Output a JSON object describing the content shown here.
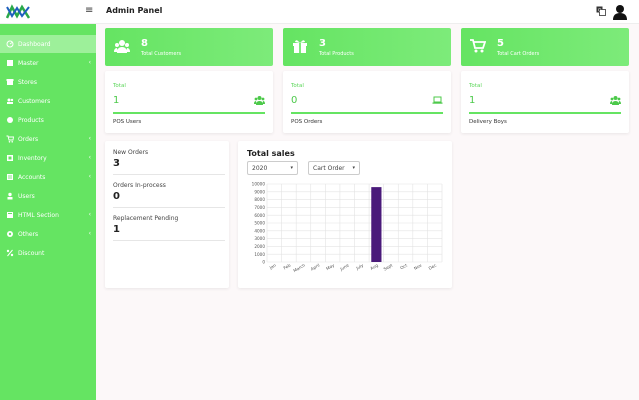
{
  "header": {
    "title": "Admin Panel",
    "menu_icon": "hamburger-icon",
    "translate_icon": "translate-icon",
    "profile_icon": "user-icon"
  },
  "sidebar": {
    "items": [
      {
        "label": "Dashboard",
        "icon": "dashboard-icon",
        "chevron": false,
        "active": true
      },
      {
        "label": "Master",
        "icon": "master-icon",
        "chevron": true,
        "active": false
      },
      {
        "label": "Stores",
        "icon": "store-icon",
        "chevron": false,
        "active": false
      },
      {
        "label": "Customers",
        "icon": "customers-icon",
        "chevron": false,
        "active": false
      },
      {
        "label": "Products",
        "icon": "products-icon",
        "chevron": false,
        "active": false
      },
      {
        "label": "Orders",
        "icon": "cart-icon",
        "chevron": true,
        "active": false
      },
      {
        "label": "Inventory",
        "icon": "inventory-icon",
        "chevron": true,
        "active": false
      },
      {
        "label": "Accounts",
        "icon": "accounts-icon",
        "chevron": true,
        "active": false
      },
      {
        "label": "Users",
        "icon": "users-icon",
        "chevron": false,
        "active": false
      },
      {
        "label": "HTML Section",
        "icon": "html-icon",
        "chevron": true,
        "active": false
      },
      {
        "label": "Others",
        "icon": "others-icon",
        "chevron": true,
        "active": false
      },
      {
        "label": "Discount",
        "icon": "percent-icon",
        "chevron": false,
        "active": false
      }
    ]
  },
  "summary_cards": [
    {
      "value": "8",
      "label": "Total Customers",
      "icon": "users-group-icon"
    },
    {
      "value": "3",
      "label": "Total Products",
      "icon": "gift-icon"
    },
    {
      "value": "5",
      "label": "Total Cart Orders",
      "icon": "cart-icon"
    }
  ],
  "detail_cards": [
    {
      "caption": "Total",
      "value": "1",
      "footer": "POS Users",
      "icon": "users-group-icon"
    },
    {
      "caption": "Total",
      "value": "0",
      "footer": "POS Orders",
      "icon": "laptop-icon"
    },
    {
      "caption": "Total",
      "value": "1",
      "footer": "Delivery Boys",
      "icon": "users-group-icon"
    }
  ],
  "order_stats": [
    {
      "label": "New Orders",
      "value": "3"
    },
    {
      "label": "Orders In-process",
      "value": "0"
    },
    {
      "label": "Replacement Pending",
      "value": "1"
    }
  ],
  "sales": {
    "title": "Total sales",
    "year_select": "2020",
    "type_select": "Cart Order"
  },
  "chart_data": {
    "type": "bar",
    "title": "Total sales",
    "categories": [
      "Jan",
      "Feb",
      "March",
      "April",
      "May",
      "June",
      "July",
      "Aug",
      "Sept",
      "Oct",
      "Nov",
      "Dec"
    ],
    "values": [
      0,
      0,
      0,
      0,
      0,
      0,
      0,
      9600,
      0,
      0,
      0,
      0
    ],
    "y_ticks": [
      "0",
      "1000",
      "2000",
      "3000",
      "4000",
      "5000",
      "6000",
      "7000",
      "8000",
      "9000",
      "10000"
    ],
    "ylim": [
      0,
      10000
    ],
    "grid": true,
    "bar_color": "#4a1a7a"
  },
  "colors": {
    "accent": "#65e462",
    "bar": "#4a1a7a"
  }
}
